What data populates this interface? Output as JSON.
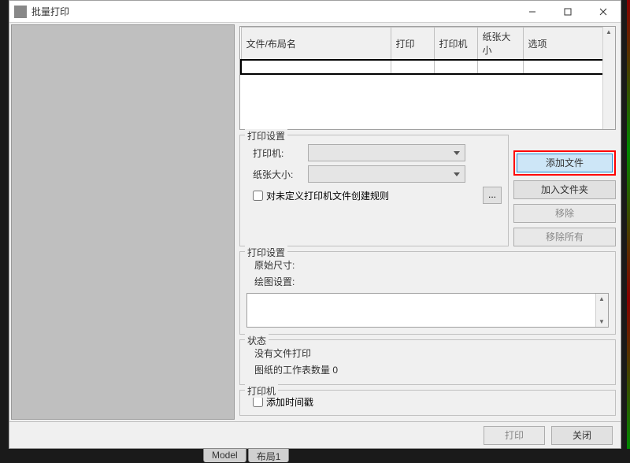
{
  "window": {
    "title": "批量打印",
    "buttons": {
      "min": "—",
      "max": "☐",
      "close": "✕"
    }
  },
  "grid": {
    "headers": [
      "文件/布局名",
      "打印",
      "打印机",
      "纸张大小",
      "选项"
    ]
  },
  "print_settings": {
    "legend": "打印设置",
    "printer_label": "打印机:",
    "paper_label": "纸张大小:",
    "undef_rule": "对未定义打印机文件创建规则",
    "ellipsis": "..."
  },
  "actions": {
    "add_file": "添加文件",
    "add_folder": "加入文件夹",
    "remove": "移除",
    "remove_all": "移除所有"
  },
  "print_cfg": {
    "legend": "打印设置",
    "orig_size": "原始尺寸:",
    "draw_set": "绘图设置:"
  },
  "status": {
    "legend": "状态",
    "no_file": "没有文件打印",
    "sheet_count_label": "图纸的工作表数量",
    "sheet_count": "0"
  },
  "printer_box": {
    "legend": "打印机",
    "timestamp": "添加时间戳"
  },
  "footer": {
    "print": "打印",
    "close": "关闭"
  },
  "tabs": {
    "model": "Model",
    "layout1": "布局1"
  }
}
